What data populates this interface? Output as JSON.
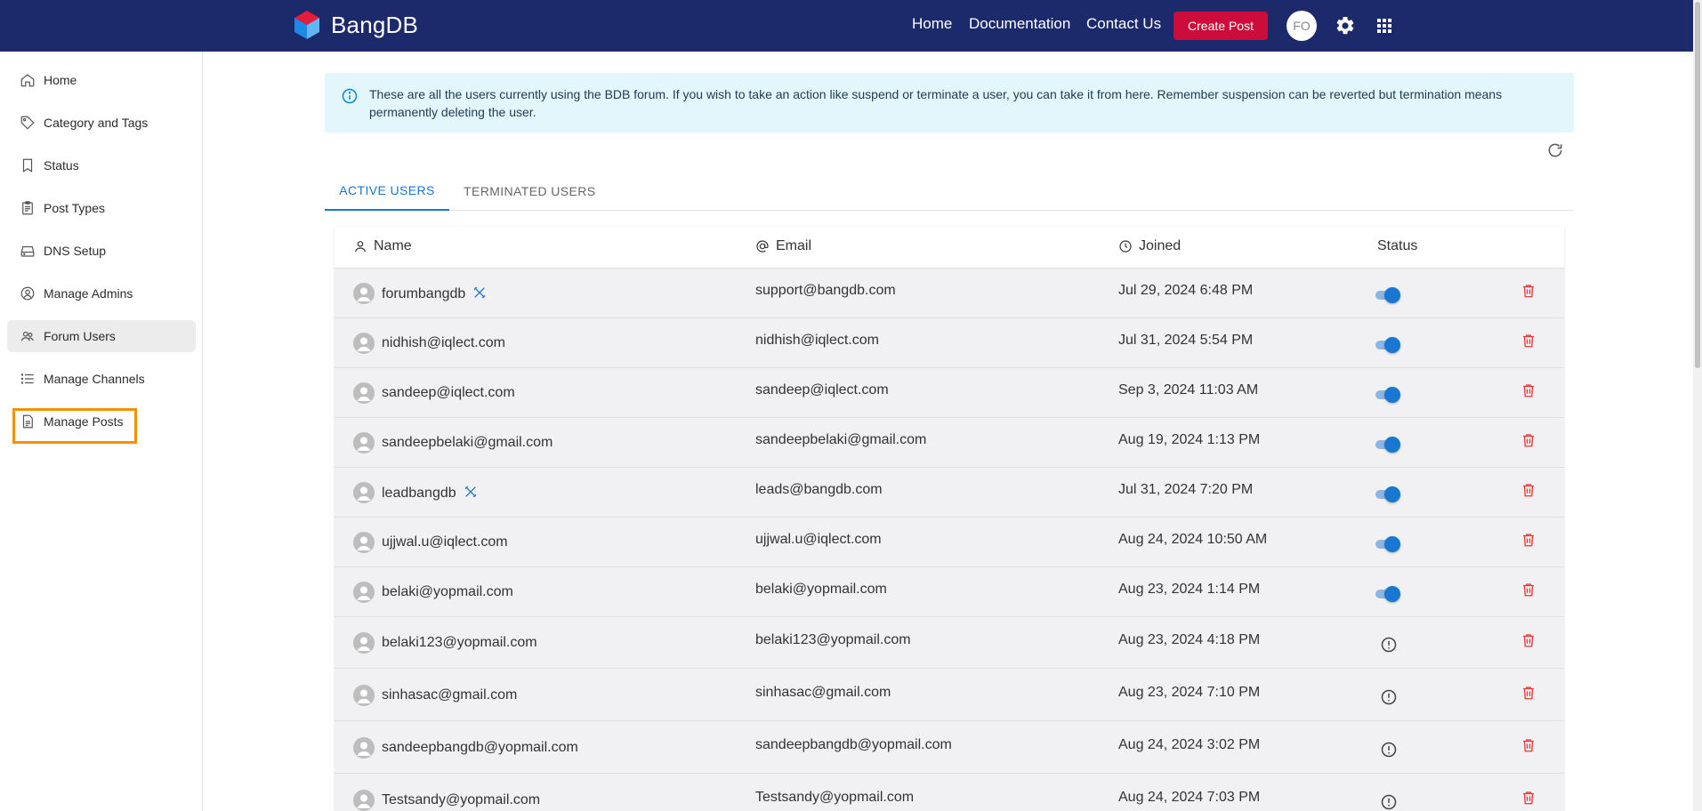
{
  "brand": {
    "name": "BangDB"
  },
  "topnav": {
    "links": [
      "Home",
      "Documentation",
      "Contact Us"
    ],
    "create_post": "Create Post",
    "avatar_initials": "FO",
    "settings_icon": "gear-icon",
    "apps_icon": "grid-icon"
  },
  "sidebar": {
    "items": [
      {
        "label": "Home",
        "icon": "home-icon"
      },
      {
        "label": "Category and Tags",
        "icon": "tag-icon"
      },
      {
        "label": "Status",
        "icon": "bookmark-icon"
      },
      {
        "label": "Post Types",
        "icon": "clipboard-icon"
      },
      {
        "label": "DNS Setup",
        "icon": "server-icon"
      },
      {
        "label": "Manage Admins",
        "icon": "user-circle-icon"
      },
      {
        "label": "Forum Users",
        "icon": "users-icon",
        "active": true
      },
      {
        "label": "Manage Channels",
        "icon": "list-icon"
      },
      {
        "label": "Manage Posts",
        "icon": "document-icon"
      }
    ]
  },
  "banner": {
    "text": "These are all the users currently using the BDB forum. If you wish to take an action like suspend or terminate a user, you can take it from here. Remember suspension can be reverted but termination means permanently deleting the user."
  },
  "tabs": {
    "active": "ACTIVE USERS",
    "terminated": "TERMINATED USERS"
  },
  "table": {
    "headers": {
      "name": "Name",
      "email": "Email",
      "joined": "Joined",
      "status": "Status"
    },
    "rows": [
      {
        "name": "forumbangdb",
        "email": "support@bangdb.com",
        "joined": "Jul 29, 2024 6:48 PM",
        "status": "active",
        "moderator": true
      },
      {
        "name": "nidhish@iqlect.com",
        "email": "nidhish@iqlect.com",
        "joined": "Jul 31, 2024 5:54 PM",
        "status": "active",
        "moderator": false
      },
      {
        "name": "sandeep@iqlect.com",
        "email": "sandeep@iqlect.com",
        "joined": "Sep 3, 2024 11:03 AM",
        "status": "active",
        "moderator": false
      },
      {
        "name": "sandeepbelaki@gmail.com",
        "email": "sandeepbelaki@gmail.com",
        "joined": "Aug 19, 2024 1:13 PM",
        "status": "active",
        "moderator": false
      },
      {
        "name": "leadbangdb",
        "email": "leads@bangdb.com",
        "joined": "Jul 31, 2024 7:20 PM",
        "status": "active",
        "moderator": true
      },
      {
        "name": "ujjwal.u@iqlect.com",
        "email": "ujjwal.u@iqlect.com",
        "joined": "Aug 24, 2024 10:50 AM",
        "status": "active",
        "moderator": false
      },
      {
        "name": "belaki@yopmail.com",
        "email": "belaki@yopmail.com",
        "joined": "Aug 23, 2024 1:14 PM",
        "status": "active",
        "moderator": false
      },
      {
        "name": "belaki123@yopmail.com",
        "email": "belaki123@yopmail.com",
        "joined": "Aug 23, 2024 4:18 PM",
        "status": "pending",
        "moderator": false
      },
      {
        "name": "sinhasac@gmail.com",
        "email": "sinhasac@gmail.com",
        "joined": "Aug 23, 2024 7:10 PM",
        "status": "pending",
        "moderator": false
      },
      {
        "name": "sandeepbangdb@yopmail.com",
        "email": "sandeepbangdb@yopmail.com",
        "joined": "Aug 24, 2024 3:02 PM",
        "status": "pending",
        "moderator": false
      },
      {
        "name": "Testsandy@yopmail.com",
        "email": "Testsandy@yopmail.com",
        "joined": "Aug 24, 2024 7:03 PM",
        "status": "pending",
        "moderator": false
      }
    ]
  },
  "colors": {
    "header_bg": "#1c2a6b",
    "create_button": "#cc0c3a",
    "accent": "#1976d2",
    "banner_bg": "#e3f6fc",
    "delete": "#e53935",
    "highlight": "#f39200"
  }
}
